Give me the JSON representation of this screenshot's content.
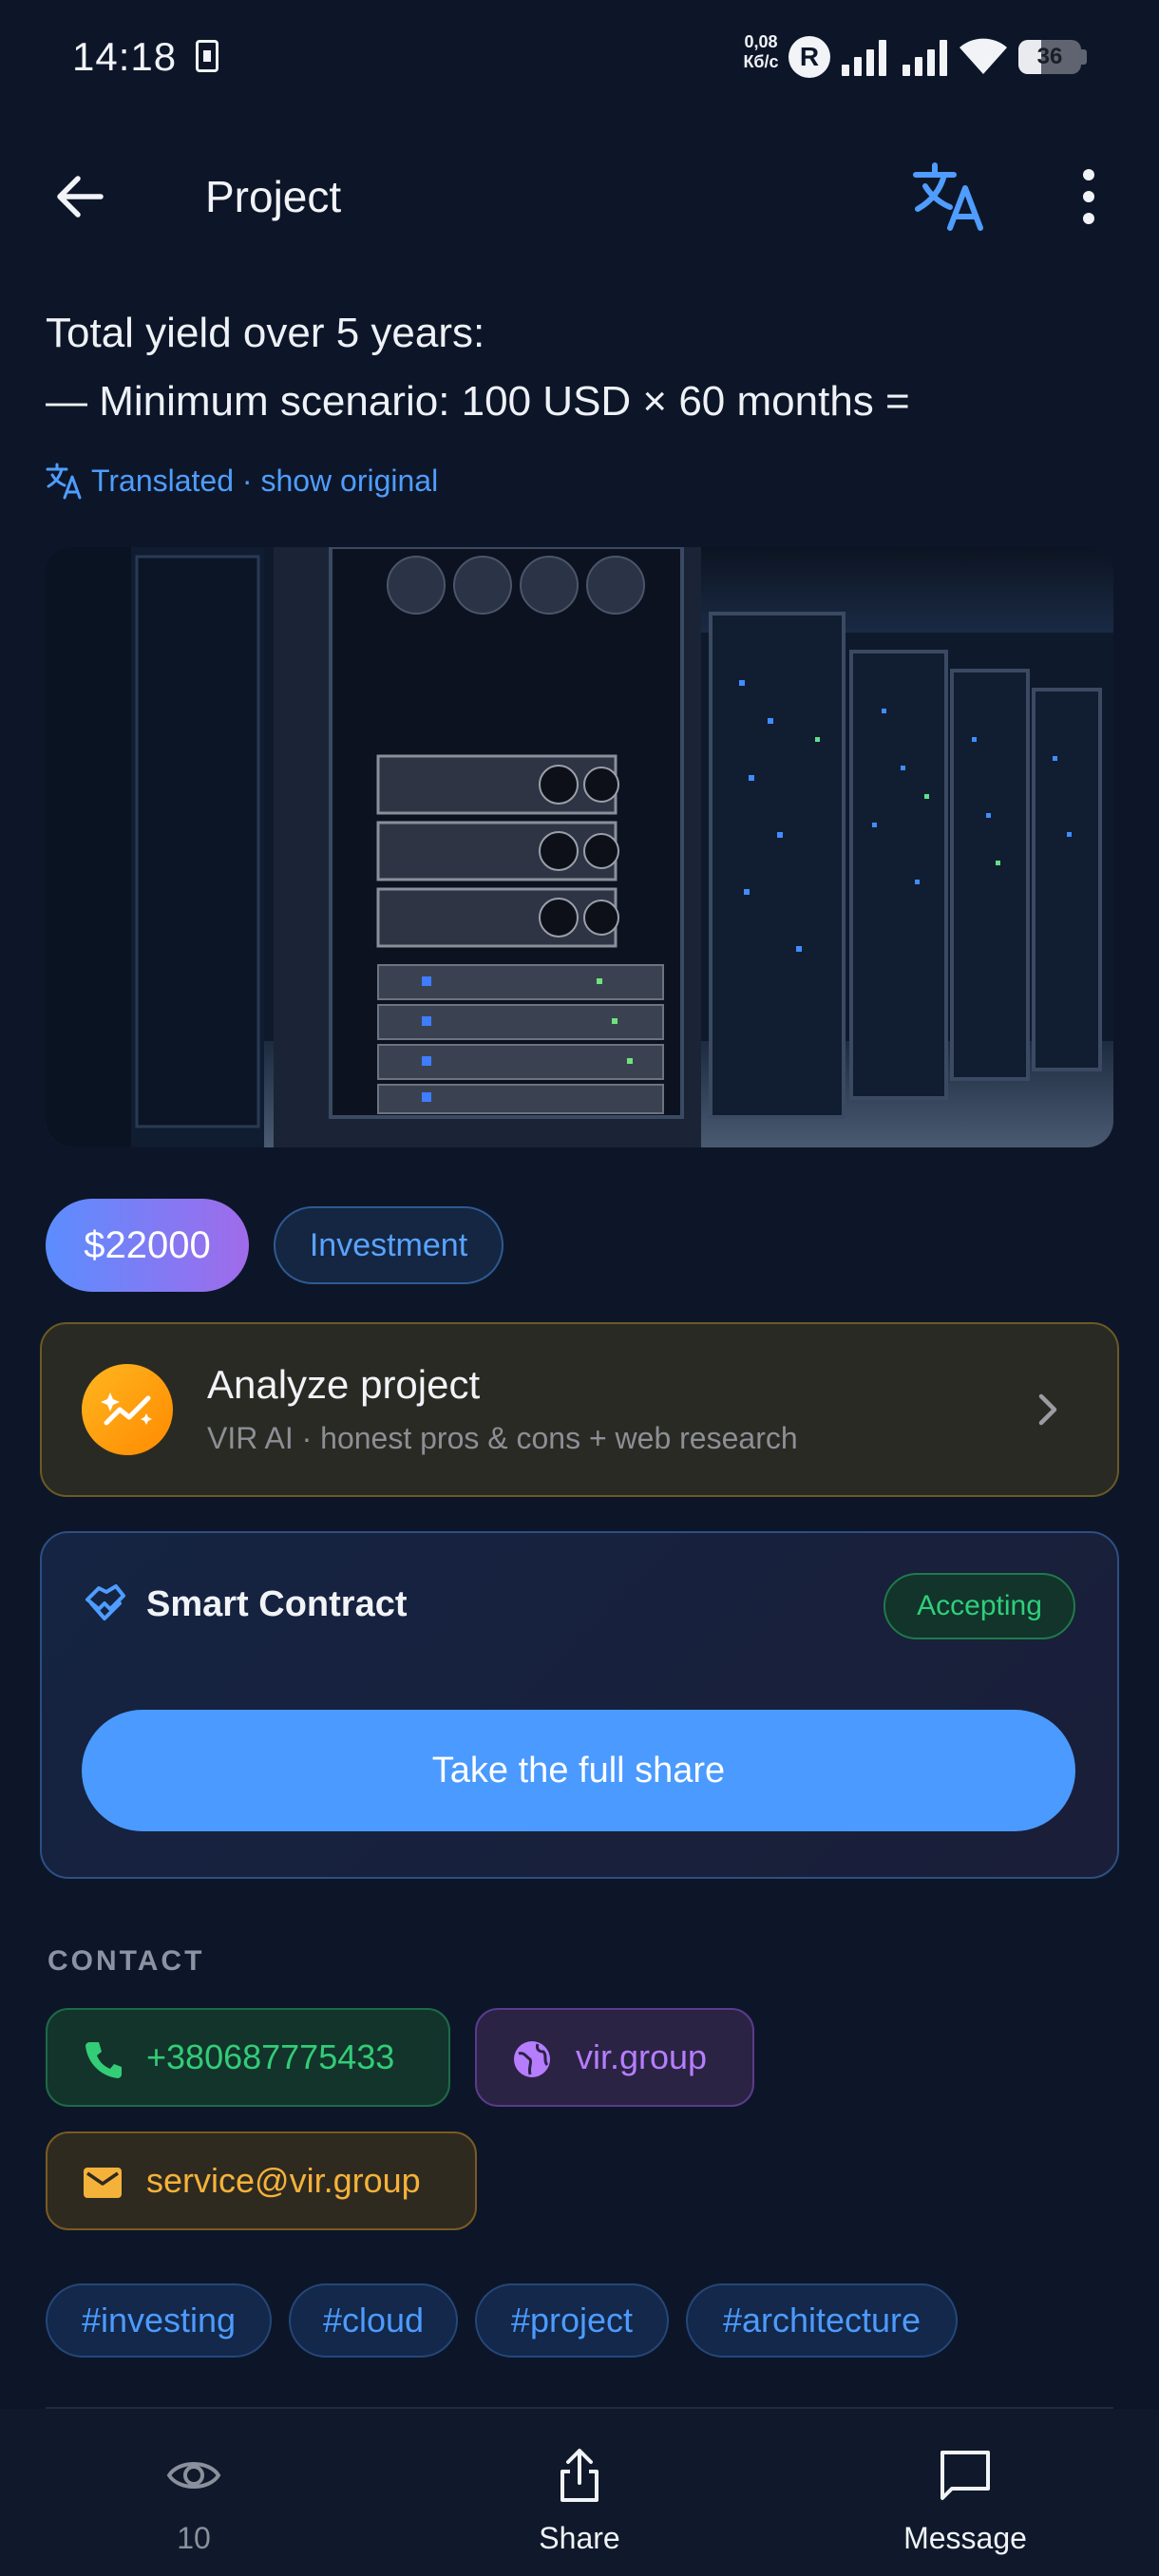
{
  "status_bar": {
    "time": "14:18",
    "net_speed_value": "0,08",
    "net_speed_unit": "Кб/с",
    "r_badge": "R",
    "battery": "36",
    "battery_level": 0.36
  },
  "app_bar": {
    "title": "Project"
  },
  "description": {
    "line1": "Total yield over 5 years:",
    "line2": "— Minimum scenario: 100 USD × 60 months ="
  },
  "translation": {
    "label": "Translated · show original"
  },
  "chips": {
    "price": "$22000",
    "category": "Investment"
  },
  "analyze": {
    "title": "Analyze project",
    "subtitle": "VIR AI · honest pros & cons + web research"
  },
  "contract": {
    "title": "Smart Contract",
    "status": "Accepting",
    "button": "Take the full share"
  },
  "contact": {
    "label": "CONTACT",
    "phone": "+380687775433",
    "website": "vir.group",
    "email": "service@vir.group"
  },
  "tags": [
    "#investing",
    "#cloud",
    "#project",
    "#architecture"
  ],
  "bottom_nav": {
    "views": "10",
    "share": "Share",
    "message": "Message"
  },
  "colors": {
    "background": "#0d1628",
    "accent": "#4a9aff",
    "success": "#2fcf7b",
    "warning": "#f5b23a",
    "purple": "#b67dff"
  },
  "icons": [
    "back-arrow-icon",
    "translate-icon",
    "more-vert-icon",
    "sparkle-chart-icon",
    "chevron-right-icon",
    "handshake-icon",
    "phone-icon",
    "globe-icon",
    "mail-icon",
    "eye-icon",
    "share-icon",
    "message-icon"
  ]
}
